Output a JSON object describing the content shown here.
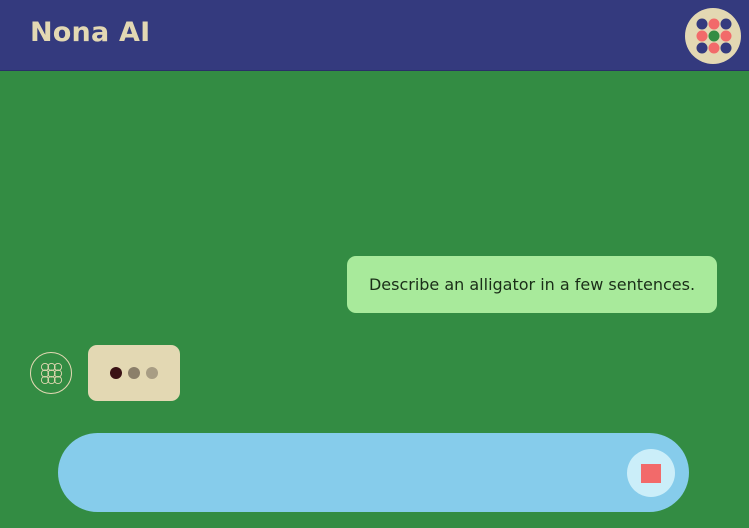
{
  "header": {
    "title": "Nona AI",
    "avatar_icon": "nine-dot-grid-logo-icon"
  },
  "chat": {
    "messages": [
      {
        "role": "user",
        "text": "Describe an alligator in a few sentences."
      }
    ],
    "assistant": {
      "avatar_icon": "nine-circle-grid-icon",
      "status": "typing"
    }
  },
  "composer": {
    "value": "",
    "placeholder": "",
    "stop_icon": "stop-square-icon"
  },
  "colors": {
    "background": "#338c43",
    "header": "#343a7e",
    "title": "#e3d8b3",
    "user_bubble": "#a8ea9b",
    "assistant_bubble": "#e3d8b3",
    "input_bar": "#86cceb",
    "stop_button": "#cbeef9",
    "stop_icon": "#f26a6a"
  }
}
